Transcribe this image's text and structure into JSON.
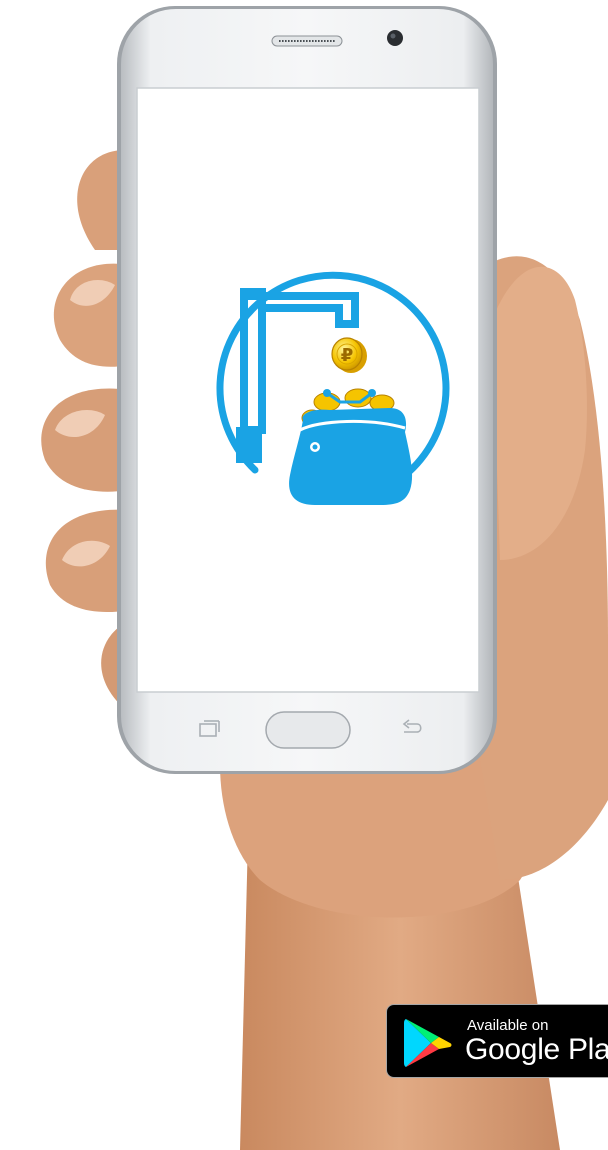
{
  "badge": {
    "line1": "Available on",
    "line2": "Google Play"
  },
  "coin": {
    "symbol": "₽"
  },
  "colors": {
    "brand_blue": "#1aa3e4",
    "coin_gold": "#f5c400",
    "phone_body": "#e7e9eb",
    "skin": "#d9a07a"
  },
  "icons": [
    "faucet-icon",
    "wallet-icon",
    "ruble-coin-icon",
    "play-store-icon",
    "recent-apps-icon",
    "home-button",
    "back-icon"
  ]
}
